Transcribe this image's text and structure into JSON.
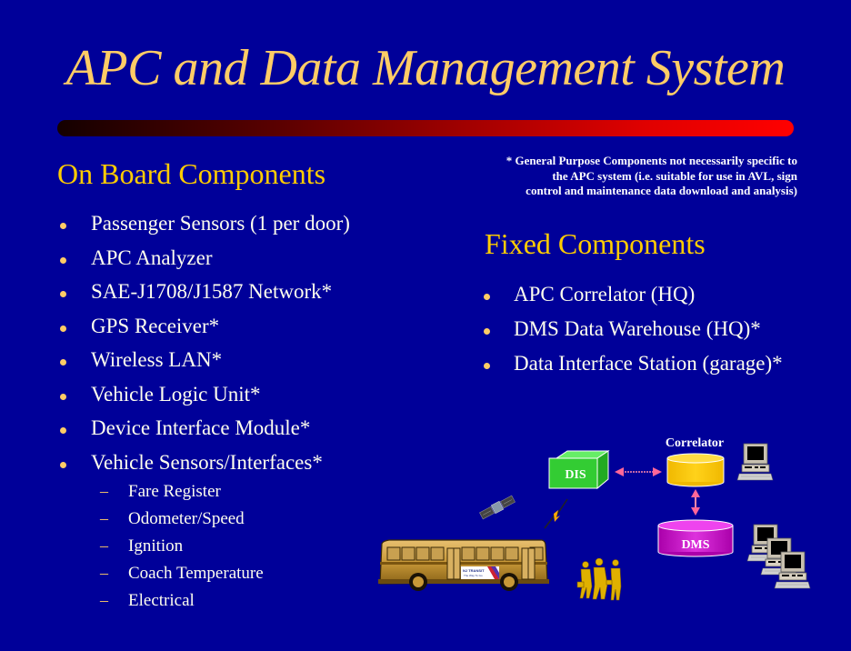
{
  "slide": {
    "title": "APC and Data Management System",
    "colors": {
      "background": "#000099",
      "title": "#ffcc66",
      "heading": "#ffcc00",
      "body_text": "#ffffee",
      "bullet": "#ffcc66",
      "rule_start": "#140000",
      "rule_end": "#ff0000"
    }
  },
  "onboard": {
    "heading": "On Board Components",
    "items": [
      {
        "label": "Passenger Sensors (1 per door)"
      },
      {
        "label": "APC Analyzer"
      },
      {
        "label": "SAE-J1708/J1587 Network*"
      },
      {
        "label": "GPS Receiver*"
      },
      {
        "label": "Wireless LAN*"
      },
      {
        "label": "Vehicle Logic Unit*"
      },
      {
        "label": "Device Interface Module*"
      },
      {
        "label": "Vehicle Sensors/Interfaces*"
      }
    ],
    "subitems": [
      {
        "marker": "–",
        "label": "Fare Register"
      },
      {
        "marker": "–",
        "label": "Odometer/Speed"
      },
      {
        "marker": "–",
        "label": "Ignition"
      },
      {
        "marker": "–",
        "label": "Coach Temperature"
      },
      {
        "marker": "–",
        "label": "Electrical"
      }
    ]
  },
  "note": {
    "lines": [
      "* General Purpose Components not necessarily specific to",
      "the APC system (i.e. suitable for use in AVL, sign",
      "control and maintenance data download and analysis)"
    ]
  },
  "fixed": {
    "heading": "Fixed Components",
    "items": [
      {
        "label": "APC Correlator (HQ)"
      },
      {
        "label": "DMS Data Warehouse (HQ)*"
      },
      {
        "label": "Data Interface Station (garage)*"
      }
    ]
  },
  "diagram": {
    "dis_label": "DIS",
    "correlator_label": "Correlator",
    "dms_label": "DMS",
    "bus_logo_line1": "NJ TRANSIT",
    "bus_logo_line2": "The Way To Go",
    "icons": [
      "satellite-icon",
      "lightning-icon",
      "bus-icon",
      "people-icon",
      "computer-icon",
      "computer-stack-icon"
    ],
    "colors": {
      "dis_box": "#33cc33",
      "correlator": "#ffcc00",
      "dms": "#cc00cc",
      "arrows": "#ff6699"
    }
  }
}
